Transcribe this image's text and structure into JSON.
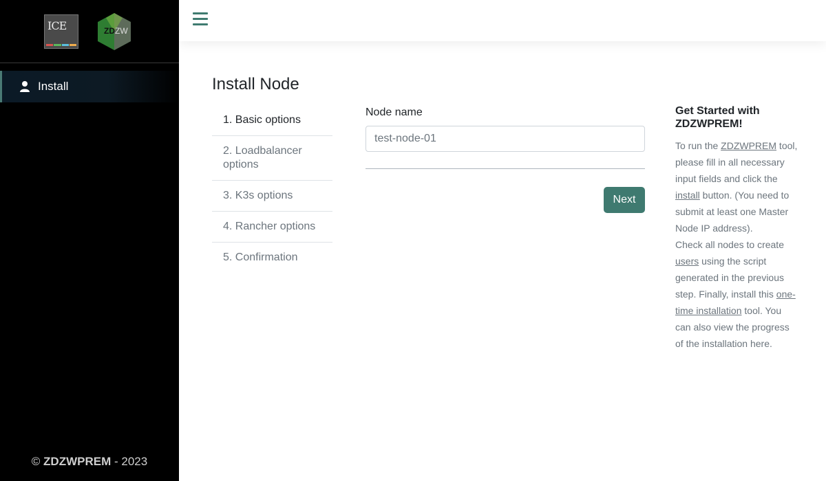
{
  "sidebar": {
    "logos": [
      {
        "name": "ICE",
        "text": "ICE"
      },
      {
        "name": "ZDZW",
        "text_dark": "ZD",
        "text_light": "ZW"
      }
    ],
    "items": [
      {
        "label": "Install",
        "icon": "user-icon",
        "active": true
      }
    ],
    "footer": {
      "copyright": "©",
      "brand": "ZDZWPREM",
      "year": "- 2023"
    }
  },
  "topbar": {
    "menu_icon": "hamburger-icon"
  },
  "main": {
    "title": "Install Node",
    "steps": [
      {
        "label": "1. Basic options",
        "active": true
      },
      {
        "label": "2. Loadbalancer options",
        "active": false
      },
      {
        "label": "3. K3s options",
        "active": false
      },
      {
        "label": "4. Rancher options",
        "active": false
      },
      {
        "label": "5. Confirmation",
        "active": false
      }
    ],
    "form": {
      "node_name_label": "Node name",
      "node_name_value": "test-node-01",
      "next_label": "Next"
    }
  },
  "help": {
    "title": "Get Started with ZDZWPREM!",
    "p1_a": "To run the ",
    "p1_link": "ZDZWPREM",
    "p1_b": " tool, please fill in all necessary input fields and click the ",
    "p1_link2": "install",
    "p1_c": " button. (You need to submit at least one Master Node IP address).",
    "p2_a": "Check all nodes to create ",
    "p2_link": "users",
    "p2_b": " using the script generated in the previous step. Finally, install this ",
    "p2_link2": "one-time installation",
    "p2_c": " tool. You can also view the progress of the installation here."
  },
  "colors": {
    "accent": "#3f7a70",
    "sidebar_bg": "#000000",
    "muted_text": "#6c757d"
  }
}
